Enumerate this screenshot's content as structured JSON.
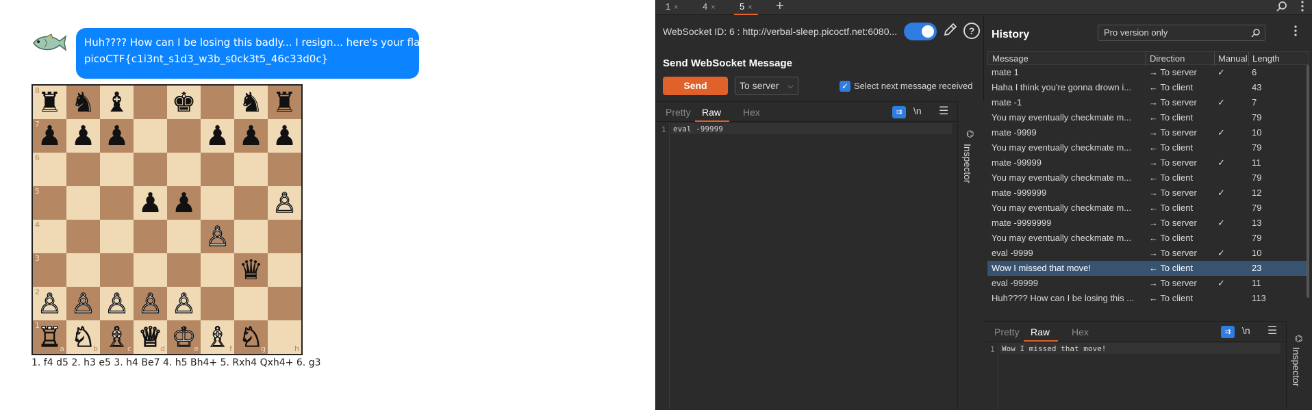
{
  "chat": {
    "line1": "Huh???? How can I be losing this badly... I resign... here's your flag:",
    "line2": "picoCTF{c1i3nt_s1d3_w3b_s0ck3t5_46c33d0c}"
  },
  "board": {
    "rows": [
      [
        "♜",
        "♞",
        "♝",
        "",
        "♚",
        "",
        "♞",
        "♜"
      ],
      [
        "♟",
        "♟",
        "♟",
        "",
        "",
        "♟",
        "♟",
        "♟"
      ],
      [
        "",
        "",
        "",
        "",
        "",
        "",
        "",
        ""
      ],
      [
        "",
        "",
        "",
        "♟",
        "♟",
        "",
        "",
        "♙"
      ],
      [
        "",
        "",
        "",
        "",
        "",
        "♙",
        "",
        ""
      ],
      [
        "",
        "",
        "",
        "",
        "",
        "",
        "♛",
        ""
      ],
      [
        "♙",
        "♙",
        "♙",
        "♙",
        "♙",
        "",
        "",
        ""
      ],
      [
        "♖",
        "♘",
        "♗",
        "♕",
        "♔",
        "♗",
        "♘",
        ""
      ]
    ],
    "rank_labels": [
      "8",
      "7",
      "6",
      "5",
      "4",
      "3",
      "2",
      "1"
    ],
    "file_labels": [
      "a",
      "b",
      "c",
      "d",
      "e",
      "f",
      "g",
      "h"
    ],
    "light_color": "#f0d9b5",
    "dark_color": "#b58863"
  },
  "moves": "1. f4 d5 2. h3 e5 3. h4 Be7 4. h5 Bh4+ 5. Rxh4 Qxh4+ 6. g3",
  "tabs": [
    {
      "label": "1",
      "close": "×"
    },
    {
      "label": "4",
      "close": "×"
    },
    {
      "label": "5",
      "close": "×"
    }
  ],
  "tab_add": "+",
  "ws": {
    "id_text": "WebSocket ID: 6 : http://verbal-sleep.picoctf.net:6080...",
    "send_title": "Send WebSocket Message",
    "send_label": "Send",
    "direction_value": "To server",
    "select_next_label": "Select next message received",
    "editor_tabs": [
      "Pretty",
      "Raw",
      "Hex"
    ],
    "newline_label": "\\n",
    "line_number": "1",
    "message": "eval -99999",
    "inspector_label": "Inspector"
  },
  "history": {
    "title": "History",
    "filter_value": "Pro version only",
    "columns": [
      "Message",
      "Direction",
      "Manual",
      "Length"
    ],
    "rows": [
      {
        "message": "mate 1",
        "direction": "→ To server",
        "manual": "✓",
        "length": "6"
      },
      {
        "message": "Haha I think you're gonna drown i...",
        "direction": "← To client",
        "manual": "",
        "length": "43"
      },
      {
        "message": "mate -1",
        "direction": "→ To server",
        "manual": "✓",
        "length": "7"
      },
      {
        "message": "You may eventually checkmate m...",
        "direction": "← To client",
        "manual": "",
        "length": "79"
      },
      {
        "message": "mate -9999",
        "direction": "→ To server",
        "manual": "✓",
        "length": "10"
      },
      {
        "message": "You may eventually checkmate m...",
        "direction": "← To client",
        "manual": "",
        "length": "79"
      },
      {
        "message": "mate -99999",
        "direction": "→ To server",
        "manual": "✓",
        "length": "11"
      },
      {
        "message": "You may eventually checkmate m...",
        "direction": "← To client",
        "manual": "",
        "length": "79"
      },
      {
        "message": "mate -999999",
        "direction": "→ To server",
        "manual": "✓",
        "length": "12"
      },
      {
        "message": "You may eventually checkmate m...",
        "direction": "← To client",
        "manual": "",
        "length": "79"
      },
      {
        "message": "mate -9999999",
        "direction": "→ To server",
        "manual": "✓",
        "length": "13"
      },
      {
        "message": "You may eventually checkmate m...",
        "direction": "← To client",
        "manual": "",
        "length": "79"
      },
      {
        "message": "eval -9999",
        "direction": "→ To server",
        "manual": "✓",
        "length": "10"
      },
      {
        "message": "Wow I missed that move!",
        "direction": "← To client",
        "manual": "",
        "length": "23",
        "selected": true
      },
      {
        "message": "eval -99999",
        "direction": "→ To server",
        "manual": "✓",
        "length": "11"
      },
      {
        "message": "Huh???? How can I be losing this ...",
        "direction": "← To client",
        "manual": "",
        "length": "113"
      }
    ],
    "editor_tabs": [
      "Pretty",
      "Raw",
      "Hex"
    ],
    "newline_label": "\\n",
    "line_number": "1",
    "message": "Wow I missed that move!",
    "inspector_label": "Inspector"
  },
  "colors": {
    "bubble": "#0d84ff",
    "accent": "#e0612a",
    "toggle": "#2f7de1",
    "selected_row": "#385370"
  },
  "icons": [
    "fish-icon",
    "search-icon",
    "kebab-menu-icon",
    "pencil-icon",
    "help-icon",
    "wrap-icon",
    "hamburger-menu-icon",
    "inspector-icon",
    "chevron-down-icon",
    "checkbox-icon",
    "check-icon"
  ]
}
